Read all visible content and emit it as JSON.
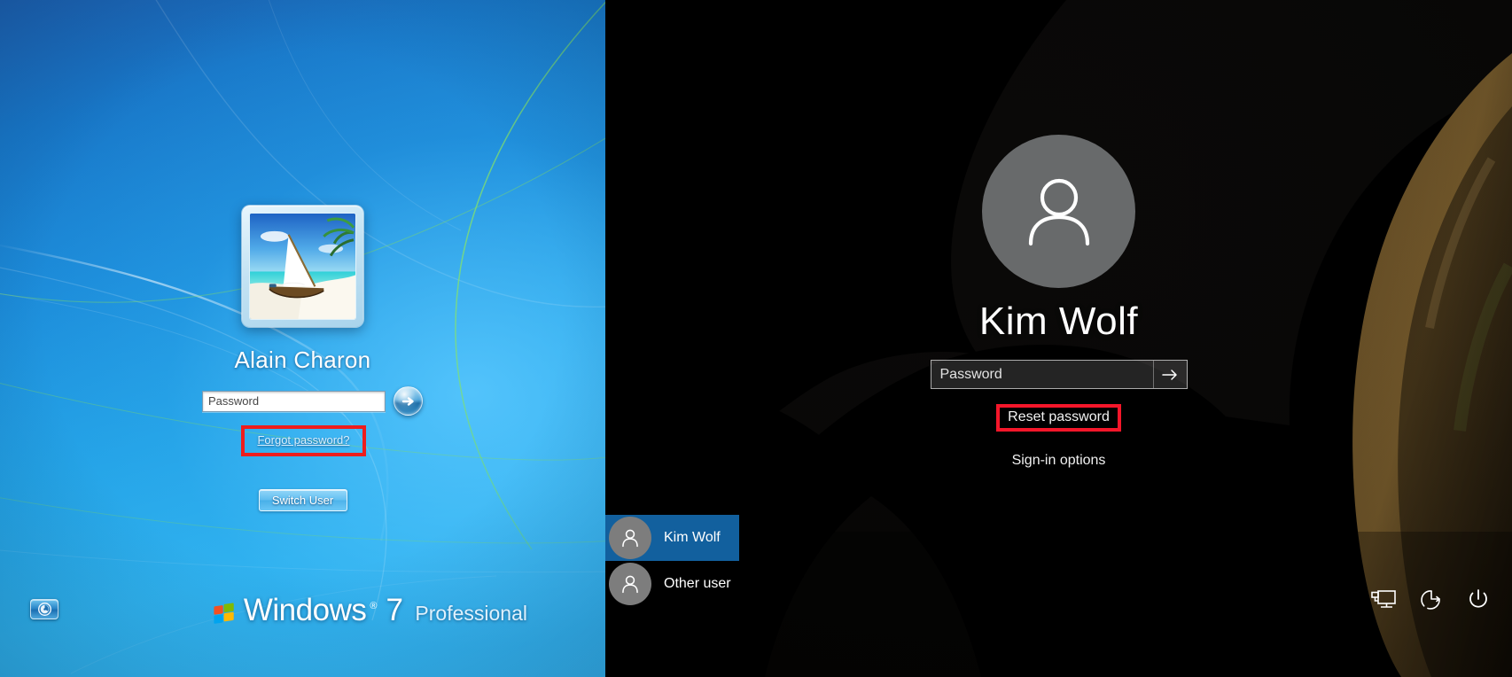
{
  "windows7": {
    "os_label": "Windows",
    "os_trademark": "®",
    "os_version": "7",
    "edition": "Professional",
    "username": "Alain Charon",
    "password_placeholder": "Password",
    "forgot_password_label": "Forgot password?",
    "switch_user_label": "Switch User",
    "submit_icon": "arrow-right-icon",
    "ease_of_access_icon": "ease-of-access-icon",
    "avatar_icon": "sailboat-beach-avatar",
    "annotation_color": "#ee1d1d",
    "accent_color": "#1b8ad8"
  },
  "windows10": {
    "username": "Kim Wolf",
    "password_placeholder": "Password",
    "submit_icon": "arrow-right-icon",
    "reset_password_label": "Reset password",
    "signin_options_label": "Sign-in options",
    "avatar_icon": "person-icon",
    "annotation_color": "#f5162a",
    "selection_color": "#12609e",
    "users": [
      {
        "label": "Kim Wolf",
        "icon": "person-icon",
        "selected": true
      },
      {
        "label": "Other user",
        "icon": "person-icon",
        "selected": false
      }
    ],
    "system_icons": [
      {
        "name": "network-icon"
      },
      {
        "name": "ease-of-access-icon"
      },
      {
        "name": "power-icon"
      }
    ]
  }
}
